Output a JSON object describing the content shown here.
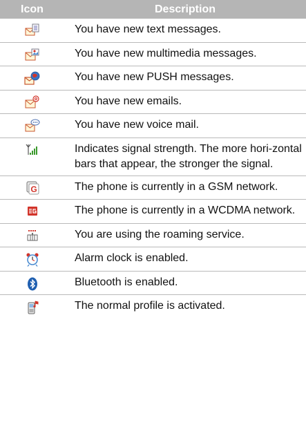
{
  "header": {
    "icon_col": "Icon",
    "desc_col": "Description"
  },
  "rows": [
    {
      "icon": "text-message-icon",
      "text": "You have new text messages."
    },
    {
      "icon": "multimedia-message-icon",
      "text": "You have new multimedia messages."
    },
    {
      "icon": "push-message-icon",
      "text": "You have new PUSH messages."
    },
    {
      "icon": "email-icon",
      "text": "You have new emails."
    },
    {
      "icon": "voice-mail-icon",
      "text": "You have new voice mail."
    },
    {
      "icon": "signal-strength-icon",
      "text": "Indicates signal strength. The more hori-zontal bars that appear, the stronger the signal."
    },
    {
      "icon": "gsm-network-icon",
      "text": "The phone is currently in a GSM network."
    },
    {
      "icon": "wcdma-network-icon",
      "text": "The phone is currently in a WCDMA network."
    },
    {
      "icon": "roaming-icon",
      "text": "You are using the roaming service."
    },
    {
      "icon": "alarm-clock-icon",
      "text": "Alarm clock is enabled."
    },
    {
      "icon": "bluetooth-icon",
      "text": "Bluetooth is enabled."
    },
    {
      "icon": "normal-profile-icon",
      "text": "The normal profile is activated."
    }
  ],
  "colors": {
    "header_bg": "#b5b5b5",
    "header_text": "#ffffff",
    "divider": "#b9b9b9"
  }
}
